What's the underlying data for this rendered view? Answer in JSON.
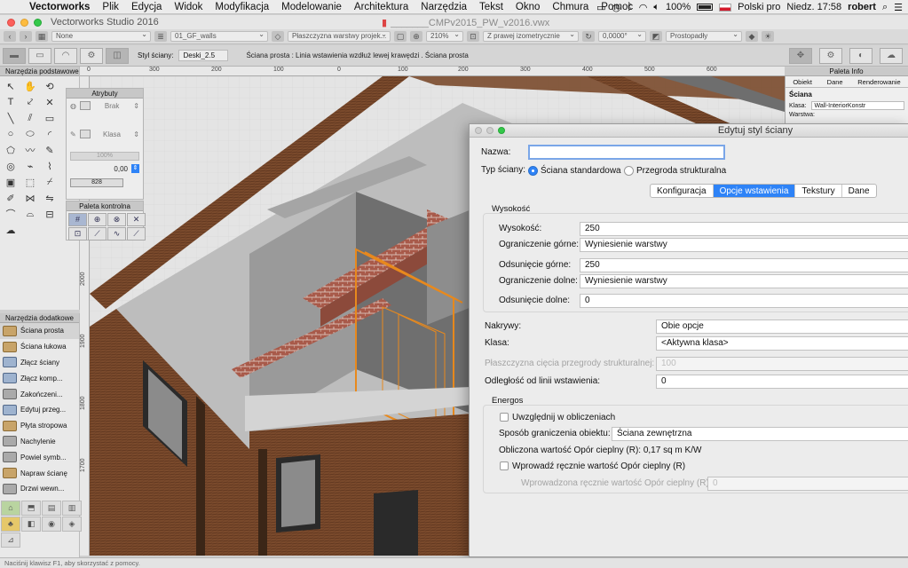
{
  "menubar": {
    "app": "Vectorworks",
    "items": [
      "Plik",
      "Edycja",
      "Widok",
      "Modyfikacja",
      "Modelowanie",
      "Architektura",
      "Narzędzia",
      "Tekst",
      "Okno",
      "Chmura",
      "Pomoc"
    ],
    "battery": "100%",
    "language": "Polski pro",
    "clock": "Niedz. 17:58",
    "user": "robert"
  },
  "window": {
    "app_title": "Vectorworks Studio 2016",
    "doc_title": "_______CMPv2015_PW_v2016.vwx"
  },
  "toolbar1": {
    "class": "None",
    "layer": "01_GF_walls",
    "plane": "Płaszczyzna warstwy projek...",
    "zoom": "210%",
    "view": "Z prawej izometrycznie",
    "angle": "0,0000°",
    "projection": "Prostopadły"
  },
  "toolbar2": {
    "wall_style_label": "Styl ściany:",
    "wall_style_value": "Deski_2.5",
    "hint": "Ściana prosta : Linia wstawienia wzdłuż lewej krawędzi . Ściana prosta"
  },
  "ruler": {
    "h": [
      "0",
      "300",
      "200",
      "100",
      "0",
      "100",
      "200",
      "300",
      "400",
      "500",
      "600"
    ],
    "v": [
      "2000",
      "1900",
      "1800",
      "1700"
    ]
  },
  "basic_palette": {
    "title": "Narzędzia podstawowe"
  },
  "attr_palette": {
    "title": "Atrybuty",
    "fill": "Brak",
    "pen": "Klasa",
    "opacity": "100%",
    "line_weight": "0,00",
    "line_value": "828"
  },
  "ctrl_palette": {
    "title": "Paleta kontrolna"
  },
  "extra_palette": {
    "title": "Narzędzia dodatkowe",
    "items": [
      "Ściana prosta",
      "Ściana łukowa",
      "Złącz ściany",
      "Złącz komp...",
      "Zakończeni...",
      "Edytuj przeg...",
      "Płyta stropowa",
      "Nachylenie",
      "Powiel symb...",
      "Napraw ścianę",
      "Drzwi wewn..."
    ]
  },
  "info_palette": {
    "title": "Paleta Info",
    "tabs": [
      "Obiekt",
      "Dane",
      "Renderowanie"
    ],
    "heading": "Ściana",
    "class_label": "Klasa:",
    "class_value": "Wall-InteriorKonstr",
    "row2_label": "Warstwa:"
  },
  "dialog": {
    "title": "Edytuj styl ściany",
    "name_label": "Nazwa:",
    "name_value": "",
    "type_label": "Typ ściany:",
    "type_opt1": "Ściana standardowa",
    "type_opt2": "Przegroda strukturalna",
    "tabs": [
      "Konfiguracja",
      "Opcje wstawienia",
      "Tekstury",
      "Dane"
    ],
    "height_group": "Wysokość",
    "height_label": "Wysokość:",
    "height_value": "250",
    "top_bound_label": "Ograniczenie górne:",
    "top_bound_value": "Wyniesienie warstwy",
    "top_offset_label": "Odsunięcie górne:",
    "top_offset_value": "250",
    "bottom_bound_label": "Ograniczenie dolne:",
    "bottom_bound_value": "Wyniesienie warstwy",
    "bottom_offset_label": "Odsunięcie dolne:",
    "bottom_offset_value": "0",
    "caps_label": "Nakrywy:",
    "caps_value": "Obie opcje",
    "class_label": "Klasa:",
    "class_value": "<Aktywna klasa>",
    "cut_plane_label": "Płaszczyzna cięcia przegrody strukturalnej:",
    "cut_plane_value": "100",
    "insert_offset_label": "Odległość od linii wstawienia:",
    "insert_offset_value": "0",
    "energos_group": "Energos",
    "include_calc": "Uwzględnij w obliczeniach",
    "boundary_label": "Sposób graniczenia obiektu:",
    "boundary_value": "Ściana zewnętrzna",
    "calc_r": "Obliczona wartość Opór cieplny (R): 0,17 sq m K/W",
    "manual_r": "Wprowadź ręcznie wartość Opór cieplny (R)",
    "manual_r_value_label": "Wprowadzona ręcznie wartość Opór cieplny (R):",
    "manual_r_value": "0"
  },
  "status": "Naciśnij klawisz F1, aby skorzystać z pomocy."
}
